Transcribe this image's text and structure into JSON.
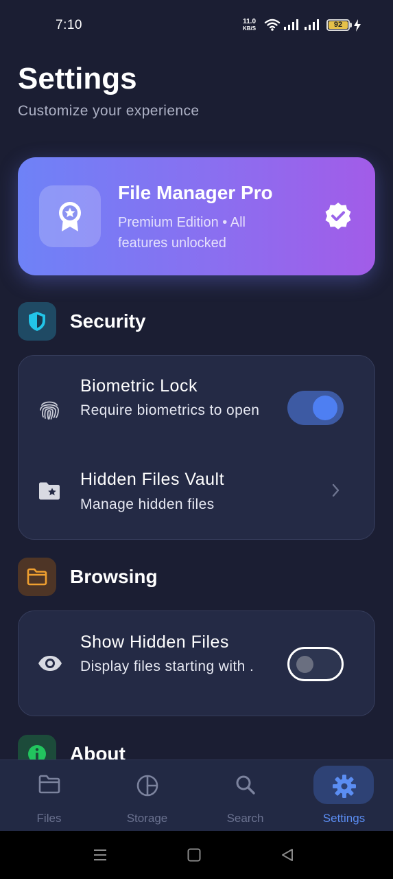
{
  "status_bar": {
    "time": "7:10",
    "net_speed_value": "11.0",
    "net_speed_unit": "KB/S",
    "battery": "92"
  },
  "header": {
    "title": "Settings",
    "subtitle": "Customize your experience"
  },
  "pro_card": {
    "title": "File Manager Pro",
    "description": "Premium Edition • All features unlocked",
    "badge_icon": "award-ribbon-icon",
    "verified_icon": "verified-check-icon"
  },
  "sections": {
    "security": {
      "title": "Security",
      "icon": "shield-icon",
      "items": [
        {
          "title": "Biometric Lock",
          "description": "Require biometrics to open",
          "icon": "fingerprint-icon",
          "toggle_on": true
        },
        {
          "title": "Hidden Files Vault",
          "description": "Manage hidden files",
          "icon": "folder-star-icon"
        }
      ]
    },
    "browsing": {
      "title": "Browsing",
      "icon": "folder-icon",
      "items": [
        {
          "title": "Show Hidden Files",
          "description": "Display files starting with .",
          "icon": "eye-icon",
          "toggle_on": false
        }
      ]
    },
    "about": {
      "title": "About",
      "icon": "info-icon"
    }
  },
  "bottom_nav": [
    {
      "label": "Files",
      "icon": "folder-icon",
      "active": false
    },
    {
      "label": "Storage",
      "icon": "pie-chart-icon",
      "active": false
    },
    {
      "label": "Search",
      "icon": "search-icon",
      "active": false
    },
    {
      "label": "Settings",
      "icon": "gear-icon",
      "active": true
    }
  ],
  "colors": {
    "background": "#1b1e33",
    "card": "#242a45",
    "accent": "#5b8df2",
    "pro_gradient_start": "#6e82f7",
    "pro_gradient_end": "#a25ce8",
    "security_accent": "#22c4e8",
    "browsing_accent": "#f0a030",
    "about_accent": "#22c55e"
  }
}
